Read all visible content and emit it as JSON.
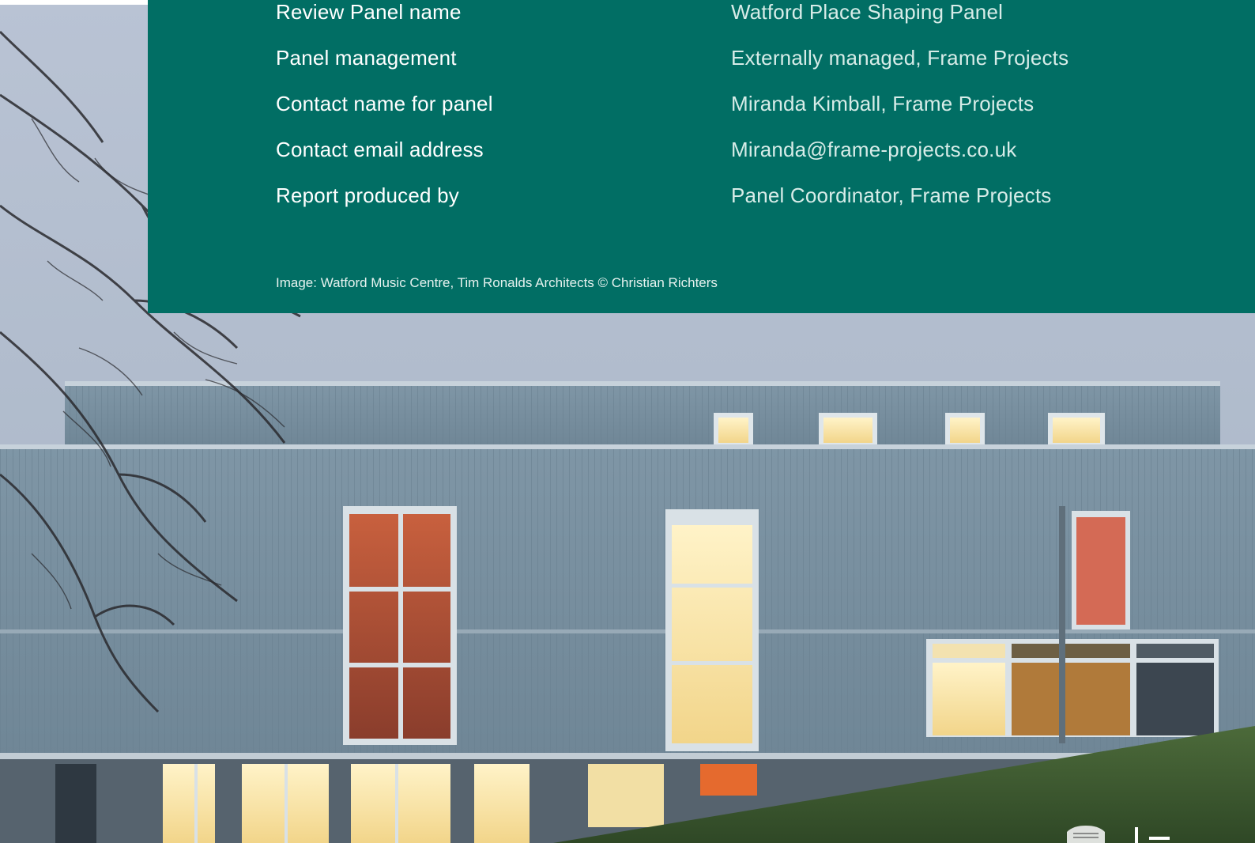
{
  "panel": {
    "rows": [
      {
        "label": "Review Panel name",
        "value": "Watford Place Shaping Panel"
      },
      {
        "label": "Panel management",
        "value": "Externally managed, Frame Projects"
      },
      {
        "label": "Contact name for panel",
        "value": "Miranda Kimball, Frame Projects"
      },
      {
        "label": "Contact email address",
        "value": "Miranda@frame-projects.co.uk"
      },
      {
        "label": "Report produced by",
        "value": "Panel Coordinator, Frame Projects"
      }
    ],
    "caption": "Image: Watford Music Centre, Tim Ronalds Architects © Christian Richters"
  },
  "colors": {
    "panel_green": "#016e64",
    "value_text": "#d7ece8"
  },
  "icons": [
    "council-crest-icon"
  ]
}
